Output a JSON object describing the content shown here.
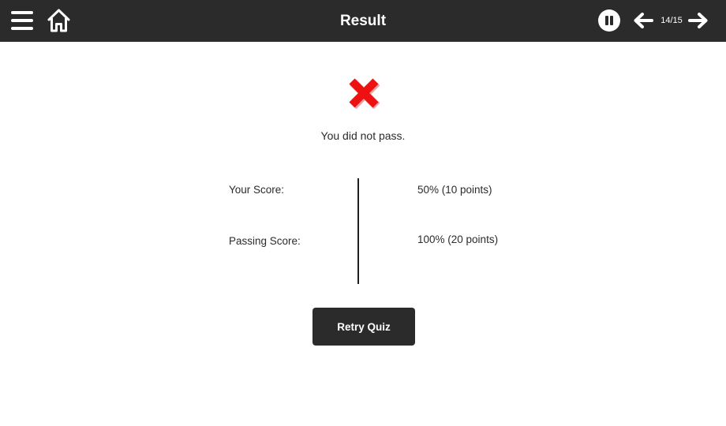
{
  "header": {
    "title": "Result",
    "page_counter": "14/15",
    "menu_icon": "hamburger-menu-icon",
    "home_icon": "home-icon",
    "pause_icon": "pause-icon",
    "prev_icon": "arrow-left-icon",
    "next_icon": "arrow-right-icon",
    "background_color": "#2b2b2b"
  },
  "result": {
    "status_icon": "red-x-icon",
    "status_color": "#ee1111",
    "message": "You did not pass.",
    "your_score_label": "Your Score:",
    "your_score_value": "50% (10 points)",
    "passing_score_label": "Passing Score:",
    "passing_score_value": "100% (20 points)"
  },
  "actions": {
    "retry_label": "Retry Quiz"
  }
}
